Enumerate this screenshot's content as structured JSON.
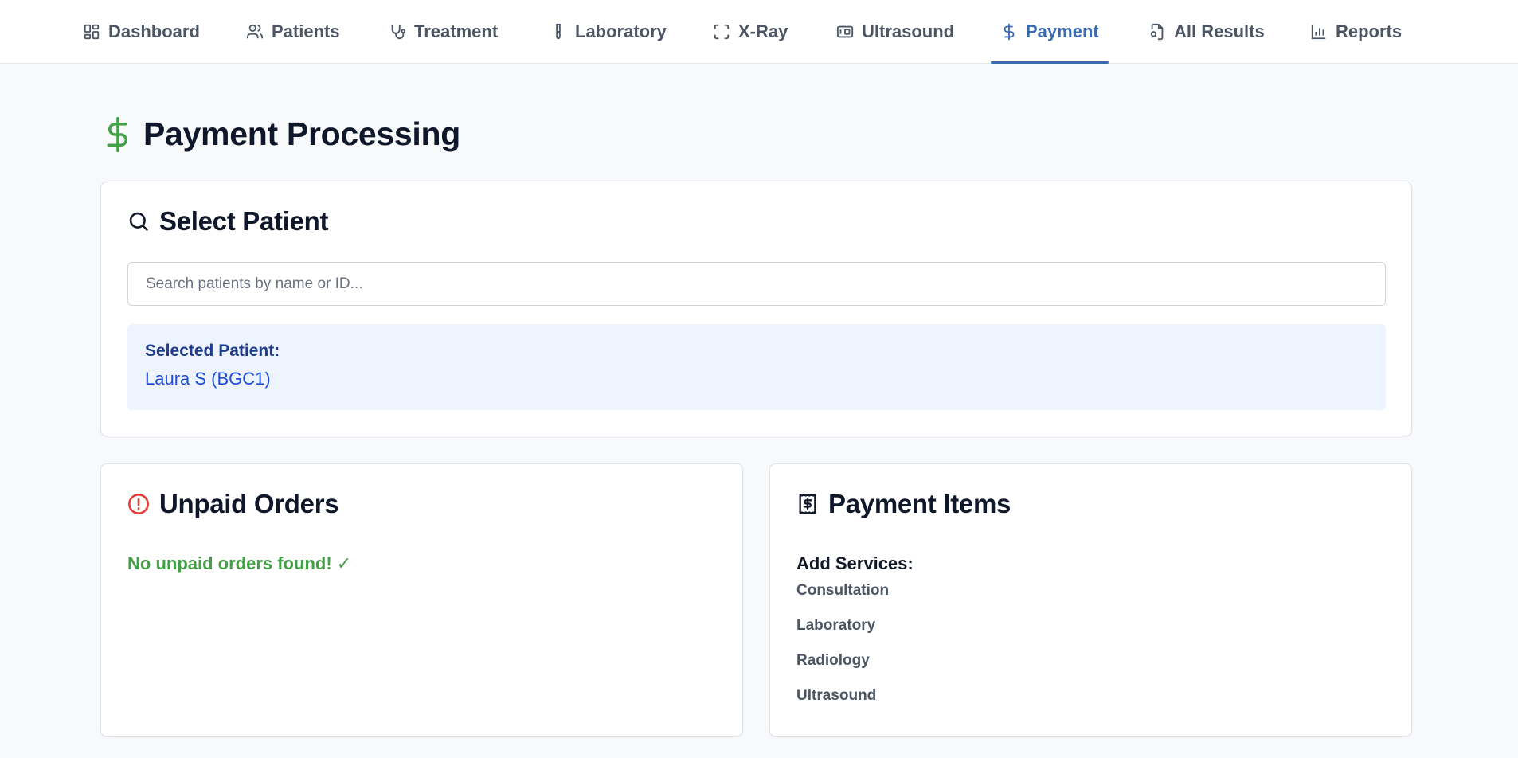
{
  "nav": {
    "tabs": [
      {
        "label": "Dashboard",
        "icon": "dashboard-icon"
      },
      {
        "label": "Patients",
        "icon": "users-icon"
      },
      {
        "label": "Treatment",
        "icon": "stethoscope-icon"
      },
      {
        "label": "Laboratory",
        "icon": "test-tube-icon"
      },
      {
        "label": "X-Ray",
        "icon": "scan-icon"
      },
      {
        "label": "Ultrasound",
        "icon": "ultrasound-icon"
      },
      {
        "label": "Payment",
        "icon": "dollar-icon"
      },
      {
        "label": "All Results",
        "icon": "file-search-icon"
      },
      {
        "label": "Reports",
        "icon": "bar-chart-icon"
      }
    ],
    "active": "Payment"
  },
  "page": {
    "title": "Payment Processing",
    "title_icon": "dollar-icon"
  },
  "select_patient": {
    "heading": "Select Patient",
    "icon": "search-icon",
    "search_placeholder": "Search patients by name or ID...",
    "selected_label": "Selected Patient:",
    "selected_value": "Laura S (BGC1)"
  },
  "unpaid_orders": {
    "heading": "Unpaid Orders",
    "icon": "alert-circle-icon",
    "empty_message": "No unpaid orders found! ✓"
  },
  "payment_items": {
    "heading": "Payment Items",
    "icon": "receipt-icon",
    "add_label": "Add Services:",
    "services": [
      "Consultation",
      "Laboratory",
      "Radiology",
      "Ultrasound"
    ]
  },
  "colors": {
    "accent": "#3a6ab0",
    "success": "#43a047",
    "danger": "#e53935",
    "selected_bg": "#eef4fe"
  }
}
